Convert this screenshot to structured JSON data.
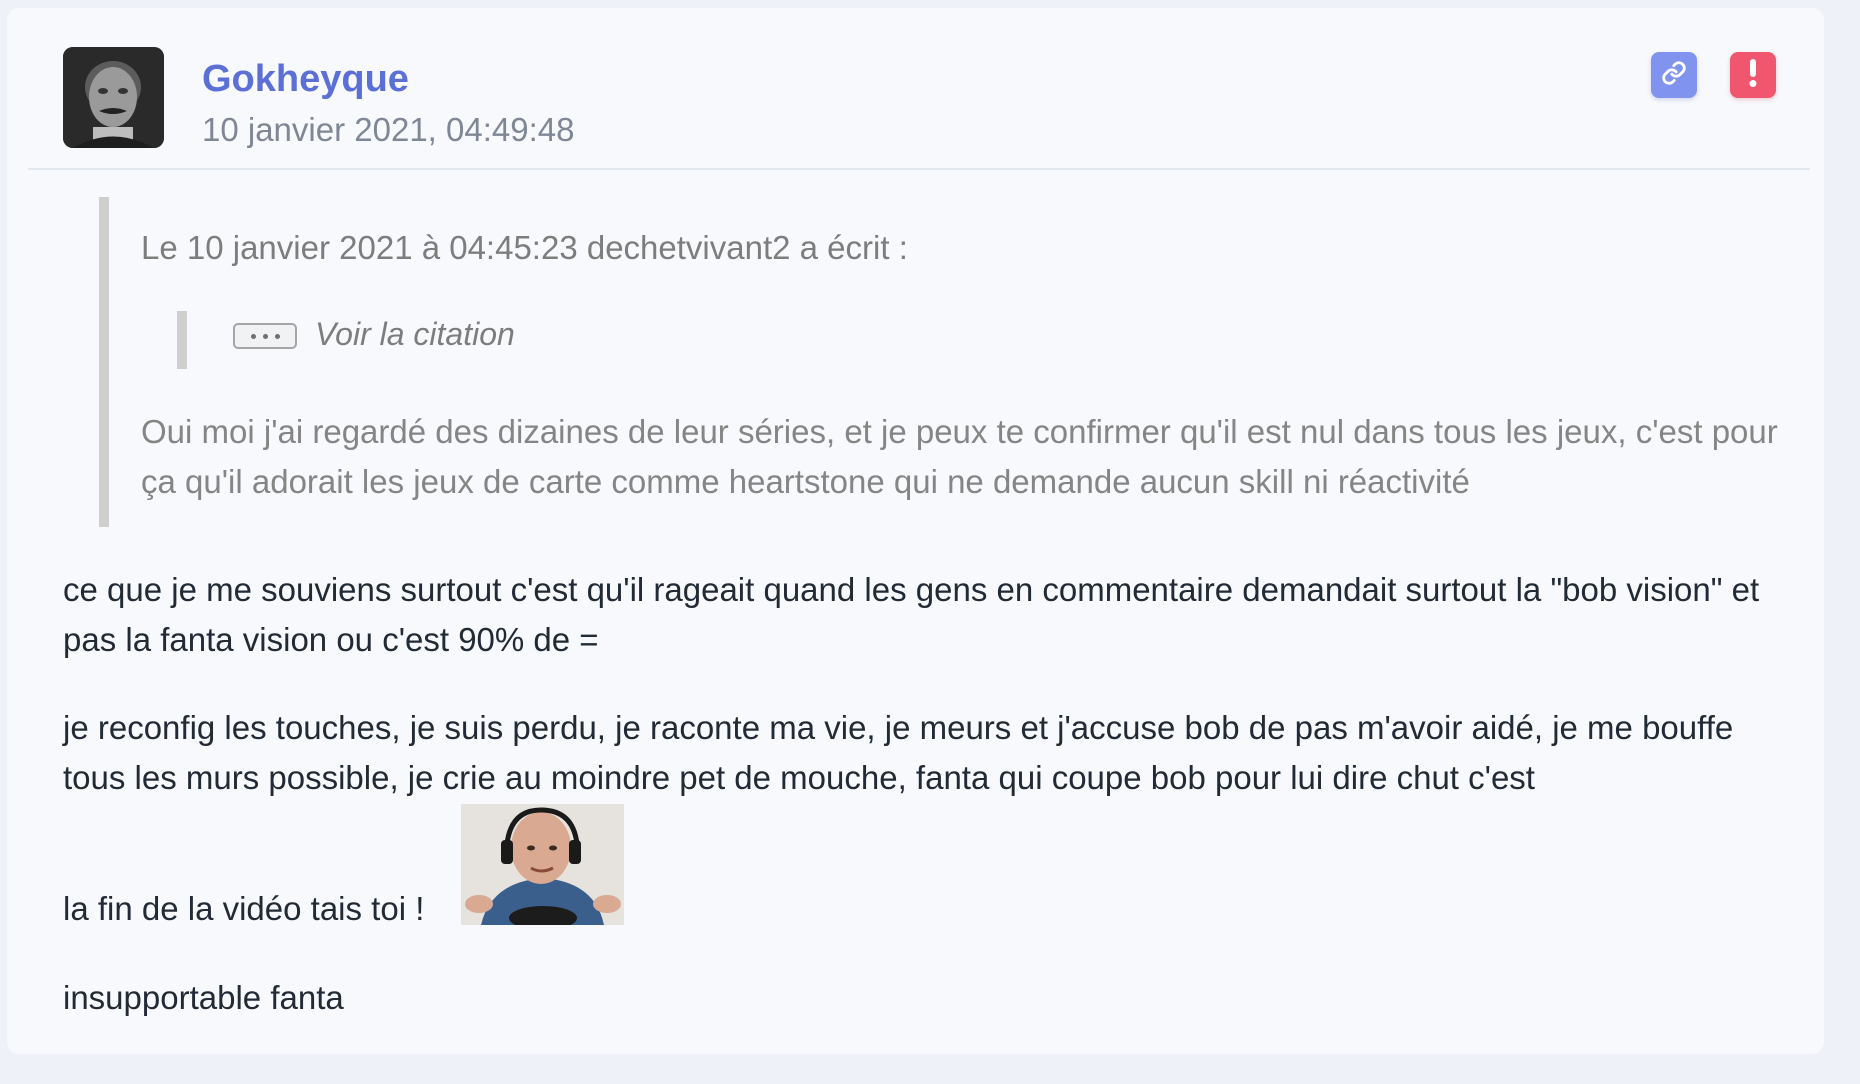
{
  "post": {
    "author": "Gokheyque",
    "timestamp": "10 janvier 2021, 04:49:48",
    "quote": {
      "header": "Le 10 janvier 2021 à 04:45:23 dechetvivant2 a écrit :",
      "nested_label": "Voir la citation",
      "text": "Oui moi j'ai regardé des dizaines de leur séries, et je peux te confirmer qu'il est nul dans tous les jeux, c'est pour ça qu'il adorait les jeux de carte comme heartstone qui ne demande aucun skill ni réactivité"
    },
    "paragraphs": {
      "p1": "ce que je me souviens surtout c'est qu'il rageait quand les gens en commentaire demandait surtout la \"bob vision\" et pas la fanta vision ou c'est 90% de =",
      "p2": "je reconfig les touches, je suis perdu, je raconte ma vie, je meurs et j'accuse bob de pas m'avoir aidé, je me bouffe tous les murs possible, je crie au moindre pet de mouche, fanta qui coupe bob pour lui dire chut c'est",
      "p3": "la fin de la vidéo tais toi !",
      "p4": "insupportable fanta"
    }
  },
  "icons": {
    "link": "link-icon",
    "report": "exclamation-icon",
    "ellipsis": "ellipsis-icon"
  },
  "colors": {
    "author": "#5b6fd6",
    "link_button": "#8093ee",
    "report_button": "#f0566e"
  }
}
